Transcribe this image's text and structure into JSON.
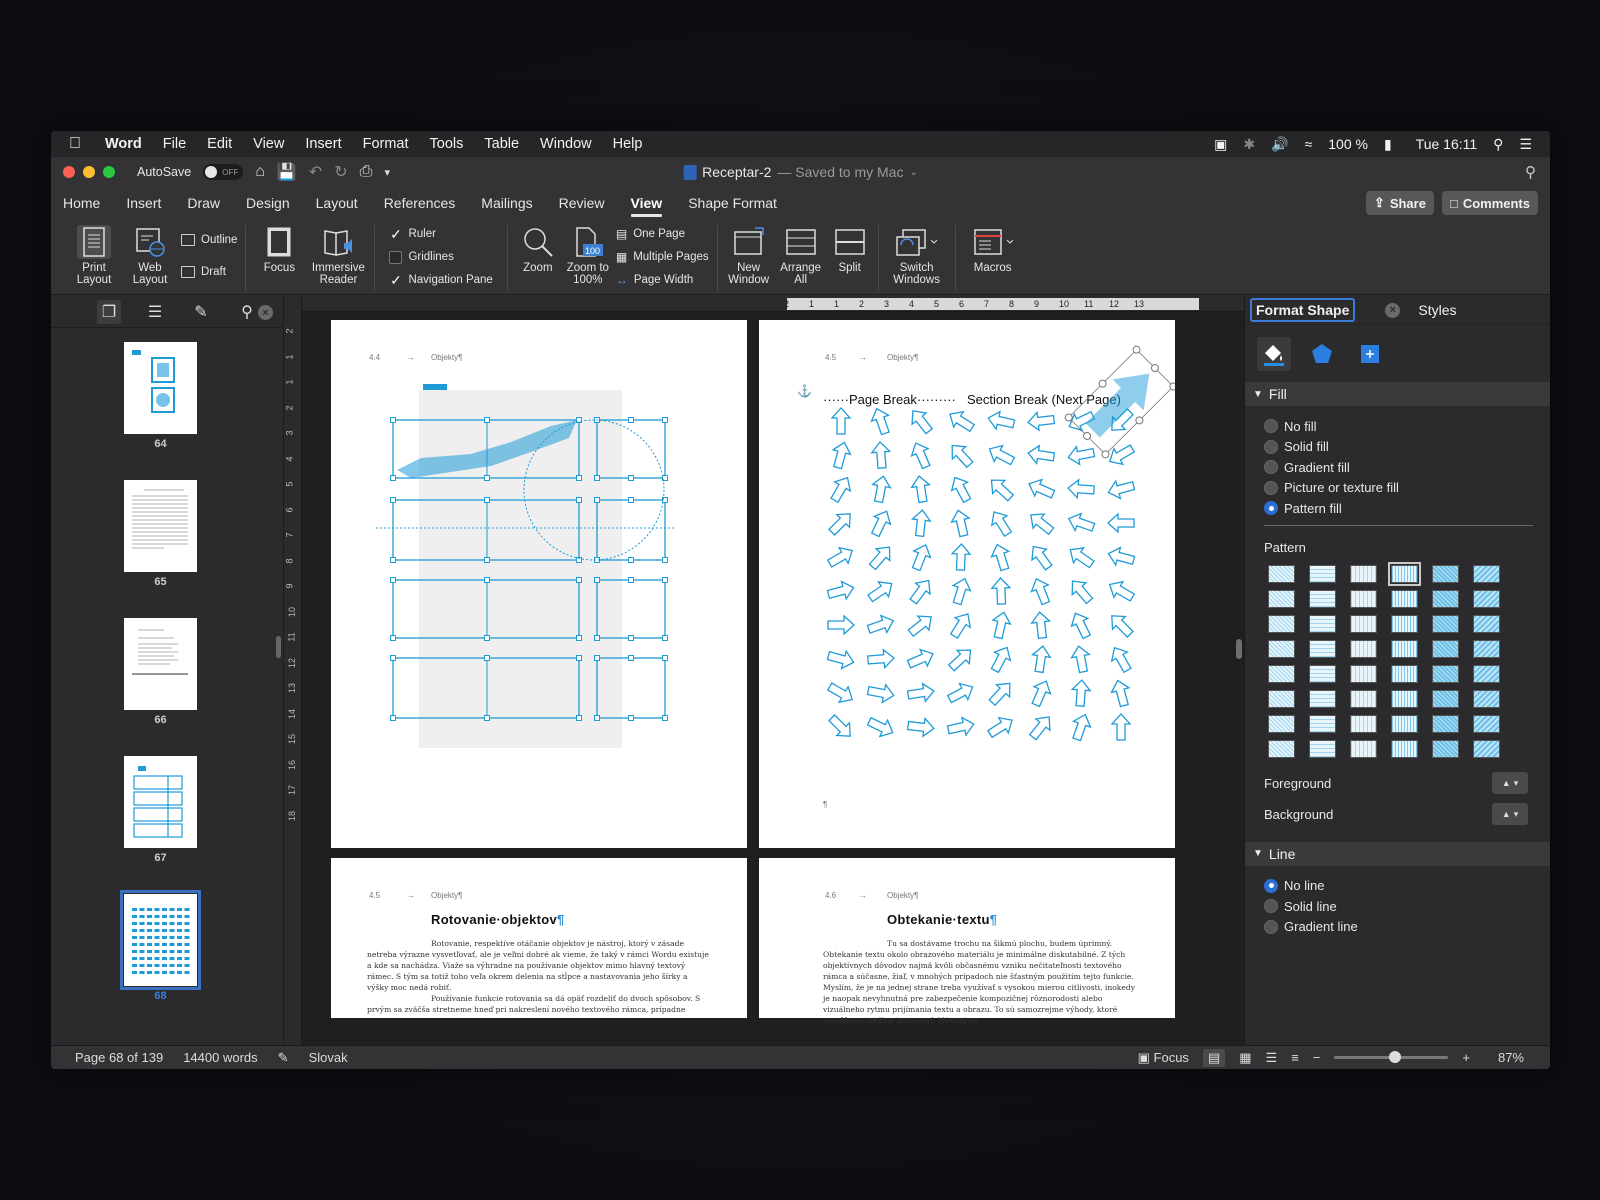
{
  "menubar": {
    "app": "Word",
    "items": [
      "File",
      "Edit",
      "View",
      "Insert",
      "Format",
      "Tools",
      "Table",
      "Window",
      "Help"
    ],
    "battery": "100 %",
    "clock": "Tue 16:11"
  },
  "titlebar": {
    "autosave_label": "AutoSave",
    "autosave_state": "OFF",
    "doc_name": "Receptar-2",
    "doc_status": "— Saved to my Mac"
  },
  "ribbon_tabs": [
    "Home",
    "Insert",
    "Draw",
    "Design",
    "Layout",
    "References",
    "Mailings",
    "Review",
    "View",
    "Shape Format"
  ],
  "active_tab": "View",
  "share_label": "Share",
  "comments_label": "Comments",
  "ribbon": {
    "print_layout": "Print Layout",
    "web_layout": "Web Layout",
    "outline": "Outline",
    "draft": "Draft",
    "focus": "Focus",
    "immersive_reader": "Immersive Reader",
    "ruler": "Ruler",
    "gridlines": "Gridlines",
    "navigation_pane": "Navigation Pane",
    "zoom": "Zoom",
    "zoom_100": "Zoom to 100%",
    "one_page": "One Page",
    "multiple_pages": "Multiple Pages",
    "page_width": "Page Width",
    "new_window": "New Window",
    "arrange_all": "Arrange All",
    "split": "Split",
    "switch_windows": "Switch Windows",
    "macros": "Macros"
  },
  "nav": {
    "thumbnails": [
      {
        "page": "64"
      },
      {
        "page": "65"
      },
      {
        "page": "66"
      },
      {
        "page": "67"
      },
      {
        "page": "68"
      }
    ]
  },
  "ruler": {
    "h_ticks": [
      "2",
      "1",
      "1",
      "2",
      "3",
      "4",
      "5",
      "6",
      "7",
      "8",
      "9",
      "10",
      "11",
      "12",
      "13"
    ],
    "v_ticks": [
      "2",
      "1",
      "1",
      "2",
      "3",
      "4",
      "5",
      "6",
      "7",
      "8",
      "9",
      "10",
      "11",
      "12",
      "13",
      "14",
      "15",
      "16",
      "17",
      "18"
    ]
  },
  "pages": {
    "p1_header_num": "4.4",
    "p1_header_title": "Objekty¶",
    "p2_header_num": "4.5",
    "p2_header_title": "Objekty¶",
    "page_break": "Page Break",
    "section_break": "Section Break (Next Page)",
    "p3_header_num": "4.5",
    "p3_header_title": "Objekty¶",
    "p3_title": "Rotovanie·objektov",
    "p3_text_1": "Rotovanie, respektíve otáčanie objektov je nástroj, ktorý v zásade netreba výrazne vysvetľovať, ale je veľmi dobré ak vieme, že taký v rámci Wordu existuje a kde sa nachádza. Viaže sa výhradne na používanie objektov mimo hlavný textový rámec. S tým sa totiž toho veľa okrem delenia na stĺpce a nastavovania jeho šírky a výšky moc nedá robiť.",
    "p3_text_2": "Používanie funkcie rotovania sa dá opäť rozdeliť do dvoch spôsobov. S prvým sa zväčša stretneme hneď pri nakreslení nového textového rámca, prípadne",
    "p4_header_num": "4.6",
    "p4_header_title": "Objekty¶",
    "p4_title": "Obtekanie·textu",
    "p4_text": "Tu sa dostávame trochu na šikmú plochu, budem úprimný. Obtekanie textu okolo obrazového materiálu je minimálne diskutabilné. Z tých objektívnych dôvodov najmä kvôli občasnému vzniku nečitateľnosti textového rámca a súčasne, žiaľ, v mnohých prípadoch nie šťastným použitím tejto funkcie. Myslím, že je na jednej strane treba využívať s vysokou mierou citlivosti, inokedy je naopak nevyhnutná pre zabezpečenie kompozičnej rôznorodosti alebo vizuálneho rytmu prijímania textu a obrazu. To sú samozrejme výhody, ktoré nemôžeme totálne ignorovať. Nástroj sa"
  },
  "format_pane": {
    "tab_format": "Format Shape",
    "tab_styles": "Styles",
    "fill_section": "Fill",
    "fill_options": [
      "No fill",
      "Solid fill",
      "Gradient fill",
      "Picture or texture fill",
      "Pattern fill"
    ],
    "fill_selected": 4,
    "pattern_label": "Pattern",
    "foreground_label": "Foreground",
    "background_label": "Background",
    "line_section": "Line",
    "line_options": [
      "No line",
      "Solid line",
      "Gradient line"
    ],
    "line_selected": 0,
    "accent_color": "#1e9bd7"
  },
  "statusbar": {
    "page": "Page 68 of 139",
    "words": "14400 words",
    "language": "Slovak",
    "focus": "Focus",
    "zoom": "87%"
  }
}
